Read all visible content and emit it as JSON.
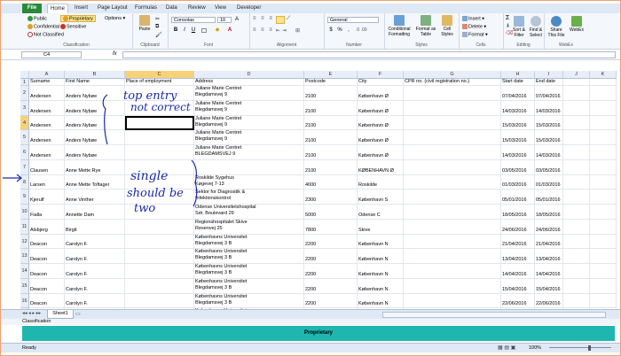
{
  "ribbon_tabs": [
    "File",
    "Home",
    "Insert",
    "Page Layout",
    "Formulas",
    "Data",
    "Review",
    "View",
    "Developer"
  ],
  "classification": {
    "public": "Public",
    "proprietary": "Proprietary",
    "confidential": "Confidential",
    "sensitive": "Sensitive",
    "not_classified": "Not Classified",
    "options": "Options",
    "group_label": "Classification"
  },
  "clipboard": {
    "paste": "Paste",
    "group_label": "Clipboard"
  },
  "font": {
    "name": "Consolas",
    "size": "10",
    "bold": "B",
    "italic": "I",
    "underline": "U",
    "group_label": "Font"
  },
  "alignment": {
    "group_label": "Alignment"
  },
  "number": {
    "format": "General",
    "currency": "$",
    "percent": "%",
    "group_label": "Number"
  },
  "styles": {
    "conditional": "Conditional Formatting",
    "format_table": "Format as Table",
    "cell_styles": "Cell Styles",
    "group_label": "Styles"
  },
  "cells": {
    "insert": "Insert",
    "delete": "Delete",
    "format": "Format",
    "group_label": "Cells"
  },
  "editing": {
    "sort": "Sort & Filter",
    "find": "Find & Select",
    "sum": "Σ",
    "group_label": "Editing"
  },
  "webex": {
    "share": "Share This File",
    "webex": "WebEx",
    "group_label": "WebEx"
  },
  "formula_bar": {
    "name_box": "C4",
    "fx": "fx",
    "value": ""
  },
  "columns": [
    "A",
    "B",
    "C",
    "D",
    "E",
    "F",
    "G",
    "H",
    "I",
    "J",
    "K"
  ],
  "header_row": {
    "row": "1",
    "A": "Surname",
    "B": "First Name",
    "C": "Place of employment",
    "D": "Address",
    "E": "Postcode",
    "F": "City",
    "G": "CPR no. (civil registration no.)",
    "H": "Start date",
    "I": "End date"
  },
  "rows": [
    {
      "row": "2",
      "A": "Andersen",
      "B": "Anders Nybøe",
      "C": "",
      "D": "Juliane Marie Centret\nBlegdamsvej 9",
      "E": "2100",
      "F": "København Ø",
      "G": "",
      "H": "07/04/2016",
      "I": "07/04/2016"
    },
    {
      "row": "3",
      "A": "Andersen",
      "B": "Anders Nybøe",
      "C": "",
      "D": "Juliane Marie Centret\nBlegdamsvej 9",
      "E": "2100",
      "F": "København Ø",
      "G": "",
      "H": "14/03/2016",
      "I": "14/03/2016"
    },
    {
      "row": "4",
      "A": "Andersen",
      "B": "Anders Nybøe",
      "C": "",
      "D": "Juliane Marie Centret\nBlegdamsvej 9",
      "E": "2100",
      "F": "København Ø",
      "G": "",
      "H": "15/03/2016",
      "I": "15/03/2016"
    },
    {
      "row": "5",
      "A": "Andersen",
      "B": "Anders Nybøe",
      "C": "",
      "D": "Juliane Marie Centret\nBlegdamsvej 9",
      "E": "2100",
      "F": "København Ø",
      "G": "",
      "H": "15/03/2016",
      "I": "15/03/2016"
    },
    {
      "row": "6",
      "A": "Andersen",
      "B": "Anders Nybøe",
      "C": "",
      "D": "Juliane Marie Centret\nBLEGDAMSVEJ 9",
      "E": "2100",
      "F": "København Ø",
      "G": "",
      "H": "14/03/2016",
      "I": "14/03/2016"
    },
    {
      "row": "7",
      "A": "Clausen",
      "B": "Anne Mette Rye",
      "C": "",
      "D": "",
      "E": "2100",
      "F": "KØBENHAVN Ø",
      "G": "",
      "H": "03/05/2016",
      "I": "03/05/2016"
    },
    {
      "row": "8",
      "A": "Larsen",
      "B": "Anne Mette Toftager",
      "C": "",
      "D": "Roskilde Sygehus\nKøgevej 7-13",
      "E": "4000",
      "F": "Roskilde",
      "G": "",
      "H": "01/03/2016",
      "I": "01/03/2016"
    },
    {
      "row": "9",
      "A": "Kjerulf",
      "B": "Anne Vinther",
      "C": "",
      "D": "Sektor for Diagnostik &\nInfektionskontrol",
      "E": "2300",
      "F": "København S",
      "G": "",
      "H": "05/01/2016",
      "I": "05/01/2016"
    },
    {
      "row": "10",
      "A": "Fialla",
      "B": "Annette Dam",
      "C": "",
      "D": "Odense Universitetshospital\nSdr. Boulevard 29",
      "E": "5000",
      "F": "Odense C",
      "G": "",
      "H": "18/05/2016",
      "I": "18/05/2016"
    },
    {
      "row": "11",
      "A": "Alsbjerg",
      "B": "Birgit",
      "C": "",
      "D": "Regionshospitalet Skive\nResenvej 25",
      "E": "7800",
      "F": "Skive",
      "G": "",
      "H": "24/06/2016",
      "I": "24/06/2016"
    },
    {
      "row": "12",
      "A": "Deacon",
      "B": "Carolyn F.",
      "C": "",
      "D": "Københavns Universitet\nBlegdamsvej 3 B",
      "E": "2200",
      "F": "København N",
      "G": "",
      "H": "21/04/2016",
      "I": "21/04/2016"
    },
    {
      "row": "13",
      "A": "Deacon",
      "B": "Carolyn F.",
      "C": "",
      "D": "Københavns Universitet\nBlegdamsvej 3 B",
      "E": "2200",
      "F": "København N",
      "G": "",
      "H": "13/04/2016",
      "I": "13/04/2016"
    },
    {
      "row": "14",
      "A": "Deacon",
      "B": "Carolyn F.",
      "C": "",
      "D": "Københavns Universitet\nBlegdamsvej 3 B",
      "E": "2200",
      "F": "København N",
      "G": "",
      "H": "14/04/2016",
      "I": "14/04/2016"
    },
    {
      "row": "15",
      "A": "Deacon",
      "B": "Carolyn F.",
      "C": "",
      "D": "Københavns Universitet\nBlegdamsvej 3 B",
      "E": "2200",
      "F": "København N",
      "G": "",
      "H": "15/04/2016",
      "I": "15/04/2016"
    },
    {
      "row": "16",
      "A": "Deacon",
      "B": "Carolyn F.",
      "C": "",
      "D": "Københavns Universitet\nBlegdamsvej 3 B",
      "E": "2200",
      "F": "København N",
      "G": "",
      "H": "22/06/2016",
      "I": "22/06/2016"
    },
    {
      "row": "17",
      "A": "Deacon",
      "B": "Carolyn F.",
      "C": "",
      "D": "Københavns Universitet\nBlegdamsvej 3 B",
      "E": "2200",
      "F": "København N",
      "G": "",
      "H": "17/06/2016",
      "I": "17/06/2016"
    }
  ],
  "annotations": {
    "top_entry": "top entry",
    "not_correct": "not correct",
    "single": "single",
    "should_be": "should be",
    "two": "two"
  },
  "sheet_tab": "Sheet1",
  "classification_bar_label": "Classification",
  "proprietary_bar": "Proprietary",
  "status": {
    "ready": "Ready",
    "zoom": "100%"
  },
  "colors": {
    "accent_teal": "#1fb6b0",
    "file_tab": "#2a8a3a",
    "ink": "#1a2aa8"
  }
}
